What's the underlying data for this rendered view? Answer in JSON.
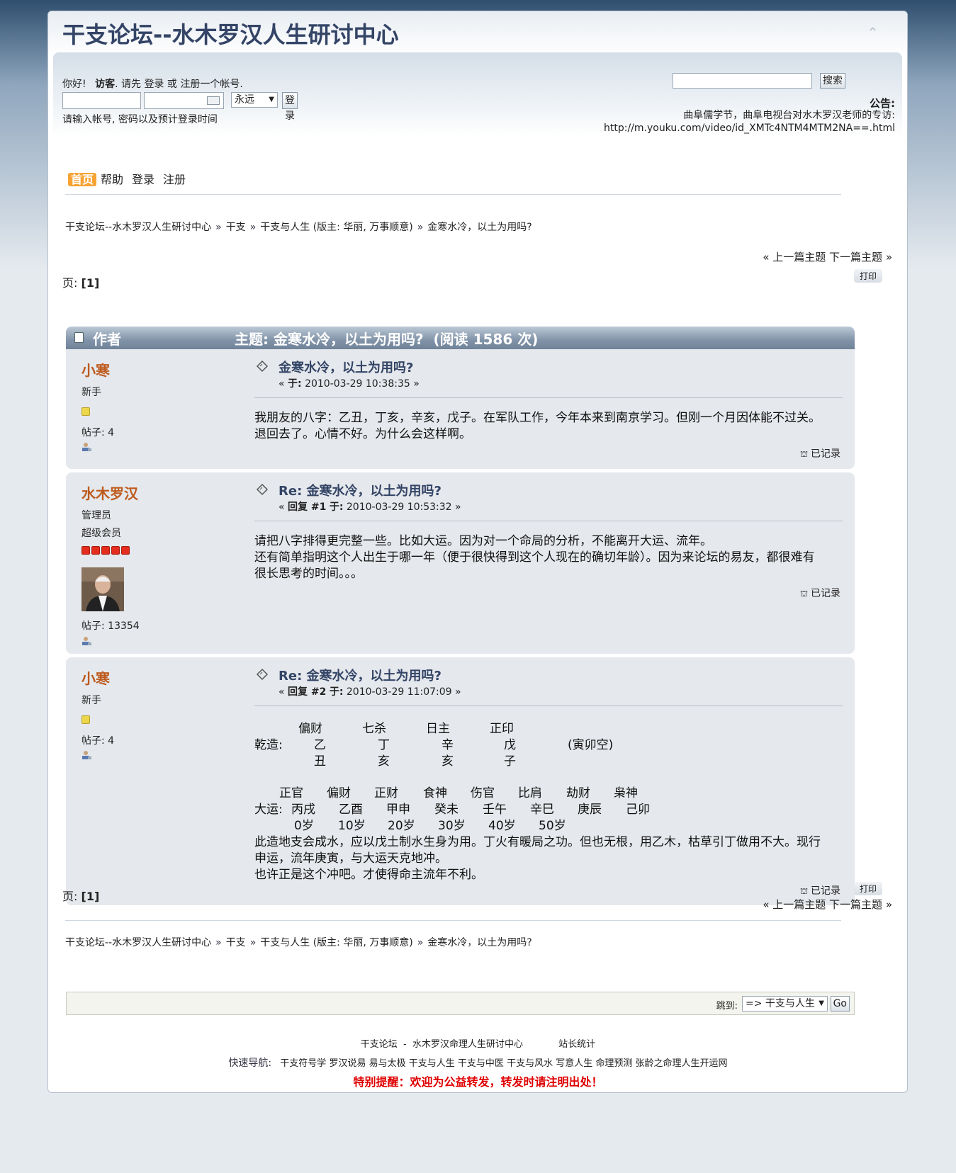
{
  "forum": {
    "title": "干支论坛--水木罗汉人生研讨中心",
    "upshrink": "⌃"
  },
  "userbox": {
    "greeting": "你好!",
    "guest": "访客",
    "prompt": ". 请先",
    "login": "登录",
    "or": "或",
    "register": "注册一个帐号",
    "dot": ".",
    "duration_selected": "永远",
    "login_button": "登录",
    "hint": "请输入帐号, 密码以及预计登录时间"
  },
  "search": {
    "button": "搜索",
    "placeholder": ""
  },
  "news": {
    "label": "公告:",
    "line1": "曲阜儒学节，曲阜电视台对水木罗汉老师的专访:",
    "line2": "http://m.youku.com/video/id_XMTc4NTM4MTM2NA==.html"
  },
  "nav": {
    "items": [
      {
        "label": "首页",
        "active": true
      },
      {
        "label": "帮助"
      },
      {
        "label": "登录"
      },
      {
        "label": "注册"
      }
    ]
  },
  "breadcrumb": {
    "items": [
      "干支论坛--水木罗汉人生研讨中心",
      "干支",
      "干支与人生 (版主: 华丽, 万事顺意)",
      "金寒水冷，以土为用吗?"
    ],
    "sep": "»"
  },
  "topicnav": {
    "prev": "« 上一篇主题",
    "next": "下一篇主题 »",
    "print": "打印",
    "pages_label": "页:",
    "pages_value": "[1]"
  },
  "header": {
    "author": "作者",
    "subject": "主题: 金寒水冷，以土为用吗?  (阅读 1586 次)"
  },
  "posts": [
    {
      "author": "小寒",
      "group": "新手",
      "posts": "帖子: 4",
      "title": "金寒水冷，以土为用吗?",
      "meta_prefix": "« ",
      "meta_label": "于:",
      "meta_date": "2010-03-29 10:38:35",
      "meta_suffix": " »",
      "body": [
        "我朋友的八字：乙丑，丁亥，辛亥，戊子。在军队工作，今年本来到南京学习。但刚一个月因体能不过关。",
        "退回去了。心情不好。为什么会这样啊。"
      ],
      "logged": "已记录"
    },
    {
      "author": "水木罗汉",
      "group": "管理员",
      "group2": "超级会员",
      "posts": "帖子: 13354",
      "title": "Re: 金寒水冷，以土为用吗?",
      "meta_prefix": "« ",
      "meta_reply": "回复 #1",
      "meta_label": "于:",
      "meta_date": "2010-03-29 10:53:32",
      "meta_suffix": " »",
      "body": [
        "请把八字排得更完整一些。比如大运。因为对一个命局的分析，不能离开大运、流年。",
        "还有简单指明这个人出生于哪一年（便于很快得到这个人现在的确切年龄）。因为来论坛的易友，都很难有",
        "很长思考的时间。。。"
      ],
      "logged": "已记录"
    },
    {
      "author": "小寒",
      "group": "新手",
      "posts": "帖子: 4",
      "title": "Re: 金寒水冷，以土为用吗?",
      "meta_prefix": "« ",
      "meta_reply": "回复 #2",
      "meta_label": "于:",
      "meta_date": "2010-03-29 11:07:09",
      "meta_suffix": " »",
      "bazi": {
        "top": [
          "偏财",
          "七杀",
          "日主",
          "正印"
        ],
        "label": "乾造:",
        "stems": [
          "乙",
          "丁",
          "辛",
          "戊"
        ],
        "note": "(寅卯空)",
        "branches": [
          "丑",
          "亥",
          "亥",
          "子"
        ]
      },
      "dayun": {
        "top": [
          "正官",
          "偏财",
          "正财",
          "食神",
          "伤官",
          "比肩",
          "劫财",
          "枭神"
        ],
        "label": "大运:",
        "pillars": [
          "丙戌",
          "乙酉",
          "甲申",
          "癸未",
          "壬午",
          "辛巳",
          "庚辰",
          "己卯"
        ],
        "ages": [
          "0岁",
          "10岁",
          "20岁",
          "30岁",
          "40岁",
          "50岁"
        ]
      },
      "body": [
        "此造地支会成水，应以戊土制水生身为用。丁火有暖局之功。但也无根，用乙木，枯草引丁做用不大。现行",
        "申运，流年庚寅，与大运天克地冲。",
        "也许正是这个冲吧。才使得命主流年不利。"
      ],
      "logged": "已记录"
    }
  ],
  "jump": {
    "label": "跳到:",
    "selected": "=> 干支与人生",
    "go": "Go"
  },
  "footer": {
    "line1a": "干支论坛  -  水木罗汉命理人生研讨中心",
    "line1b": "站长统计",
    "nav_label": "快速导航:",
    "links": [
      "干支符号学",
      "罗汉说易",
      "易与太极",
      "干支与人生",
      "干支与中医",
      "干支与风水",
      "写意人生",
      "命理预测",
      "张龄之命理人生开运网"
    ],
    "notice": "特别提醒：欢迎为公益转发，转发时请注明出处！"
  },
  "colors": {
    "author_name": "#bd5a1e",
    "title_blue": "#334466",
    "notice_red": "#e00000",
    "nav_active": "#f7a333"
  }
}
